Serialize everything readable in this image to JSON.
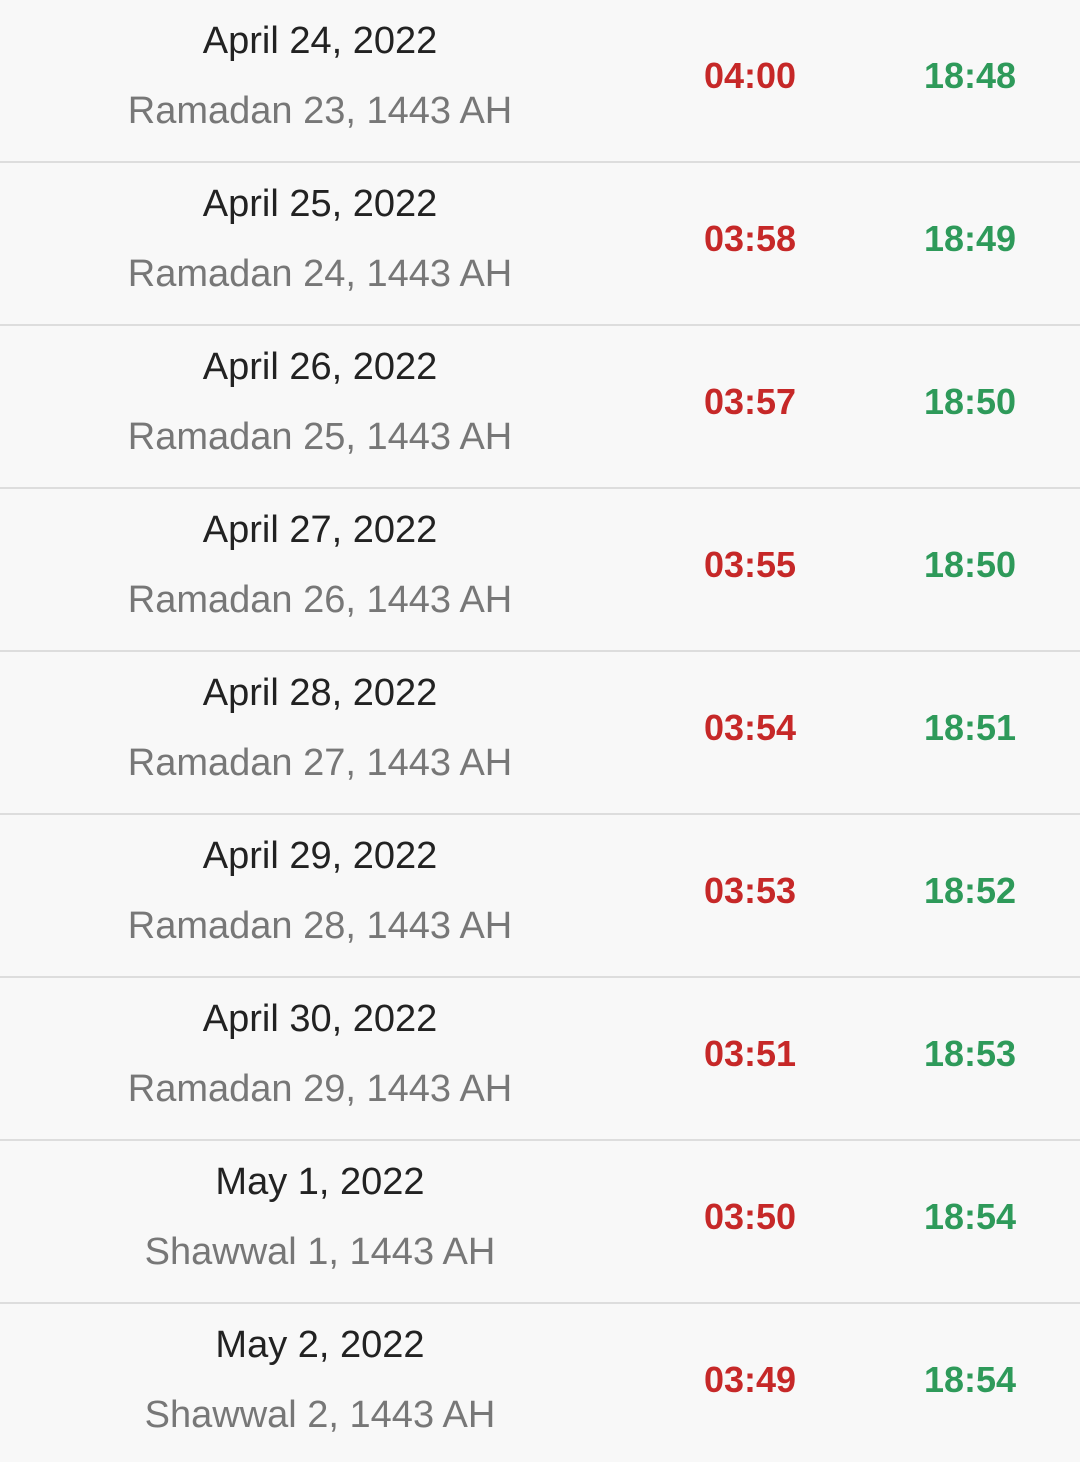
{
  "colors": {
    "background": "#f8f8f8",
    "divider": "#dddddd",
    "gregorian_text": "#222222",
    "hijri_text": "#777777",
    "sahur_time": "#c62828",
    "iftar_time": "#2e9a5a"
  },
  "rows": [
    {
      "gregorian": "April 24, 2022",
      "hijri": "Ramadan 23, 1443 AH",
      "sahur": "04:00",
      "iftar": "18:48"
    },
    {
      "gregorian": "April 25, 2022",
      "hijri": "Ramadan 24, 1443 AH",
      "sahur": "03:58",
      "iftar": "18:49"
    },
    {
      "gregorian": "April 26, 2022",
      "hijri": "Ramadan 25, 1443 AH",
      "sahur": "03:57",
      "iftar": "18:50"
    },
    {
      "gregorian": "April 27, 2022",
      "hijri": "Ramadan 26, 1443 AH",
      "sahur": "03:55",
      "iftar": "18:50"
    },
    {
      "gregorian": "April 28, 2022",
      "hijri": "Ramadan 27, 1443 AH",
      "sahur": "03:54",
      "iftar": "18:51"
    },
    {
      "gregorian": "April 29, 2022",
      "hijri": "Ramadan 28, 1443 AH",
      "sahur": "03:53",
      "iftar": "18:52"
    },
    {
      "gregorian": "April 30, 2022",
      "hijri": "Ramadan 29, 1443 AH",
      "sahur": "03:51",
      "iftar": "18:53"
    },
    {
      "gregorian": "May 1, 2022",
      "hijri": "Shawwal 1, 1443 AH",
      "sahur": "03:50",
      "iftar": "18:54"
    },
    {
      "gregorian": "May 2, 2022",
      "hijri": "Shawwal 2, 1443 AH",
      "sahur": "03:49",
      "iftar": "18:54"
    }
  ]
}
